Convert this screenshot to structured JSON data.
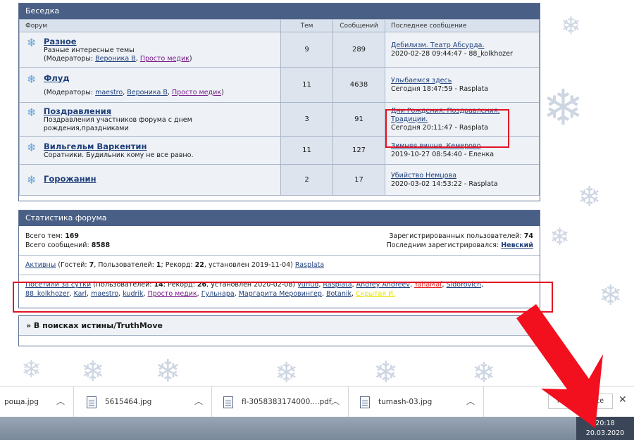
{
  "forum_section": {
    "title": "Беседка",
    "columns": {
      "forum": "Форум",
      "topics": "Тем",
      "posts": "Сообщений",
      "last": "Последнее сообщение"
    },
    "rows": [
      {
        "title": "Разное",
        "desc": "Разные интересные темы",
        "mods_label": "(Модераторы: ",
        "mods": [
          "Вероника В",
          "Просто медик"
        ],
        "mods_end": ")",
        "topics": "9",
        "posts": "289",
        "last_link": "Дебилизм. Театр Абсурда.",
        "last_meta": "2020-02-28 09:44:47 - 88_kolkhozer"
      },
      {
        "title": "Флуд",
        "desc": "",
        "mods_label": "(Модераторы: ",
        "mods": [
          "maestro",
          "Вероника В",
          "Просто медик"
        ],
        "mods_end": ")",
        "topics": "11",
        "posts": "4638",
        "last_link": "Улыбаемся здесь",
        "last_meta": "Сегодня 18:47:59 - Rasplata"
      },
      {
        "title": "Поздравления",
        "desc": "Поздравления участников форума с днем рождения,праздниками",
        "mods_label": "",
        "mods": [],
        "mods_end": "",
        "topics": "3",
        "posts": "91",
        "last_link": "Дни Рождения. Поздравления. Традиции.",
        "last_meta": "Сегодня 20:11:47 - Rasplata"
      },
      {
        "title": "Вильгельм Варкентин",
        "desc": "Соратники. Будильник кому не все равно.",
        "mods_label": "",
        "mods": [],
        "mods_end": "",
        "topics": "11",
        "posts": "127",
        "last_link": "Зимняя вишня. Кемерово",
        "last_meta": "2019-10-27 08:54:40 - Еленка"
      },
      {
        "title": "Горожанин",
        "desc": "",
        "mods_label": "",
        "mods": [],
        "mods_end": "",
        "topics": "2",
        "posts": "17",
        "last_link": "Убийство Немцова",
        "last_meta": "2020-03-02 14:53:22 - Rasplata"
      }
    ]
  },
  "stats": {
    "title": "Статистика форума",
    "topics_label": "Всего тем: ",
    "topics_value": "169",
    "posts_label": "Всего сообщений: ",
    "posts_value": "8588",
    "registered_label": "Зарегистрированных пользователей: ",
    "registered_value": "74",
    "last_reg_label": "Последним зарегистрировался: ",
    "last_reg_value": "Невский",
    "active_link": "Активны",
    "active_text_1": " (Гостей: ",
    "guests": "7",
    "active_text_2": ", Пользователей: ",
    "users": "1",
    "active_text_3": "; Рекорд: ",
    "record": "22",
    "active_text_4": ", установлен 2019-11-04) ",
    "active_user": "Rasplata",
    "visited_link": "Посетили за сутки",
    "visited_text_1": " (Пользователей: ",
    "visited_users": "14",
    "visited_text_2": "; Рекорд: ",
    "visited_record": "26",
    "visited_text_3": ", установлен 2020-02-08) ",
    "visitors": [
      "yuriud",
      "Rasplata",
      "Andrey Andreev",
      "YanaMaf",
      "Sidorovich",
      "88_kolkhozer",
      "Karl",
      "maestro",
      "kudrik",
      "Просто медик",
      "Гульнара",
      "Маргарита Меровингер",
      "Botanik",
      "Скрытая И."
    ]
  },
  "truth": {
    "title": "» В поисках истины/TruthMove"
  },
  "downloads": {
    "items": [
      "роща.jpg",
      "5615464.jpg",
      "fl-3058383174000....pdf",
      "tumash-03.jpg"
    ],
    "show_all": "Показать все",
    "close": "✕"
  },
  "taskbar": {
    "time": "20:18",
    "date": "20.03.2020"
  },
  "icons": {
    "forum": "snowflake-icon",
    "file": "file-icon",
    "caret": "chevron-up-icon"
  },
  "colors": {
    "header": "#4a5f86",
    "highlight": "#e01424"
  }
}
